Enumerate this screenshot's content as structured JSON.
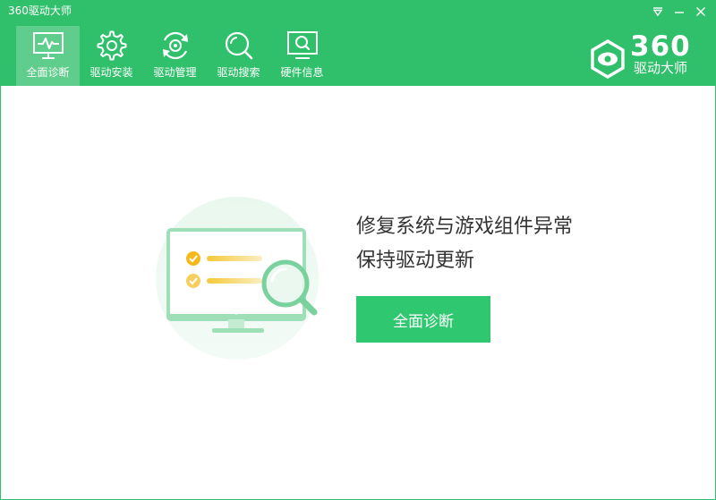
{
  "app": {
    "title": "360驱动大师"
  },
  "window_controls": [
    {
      "name": "menu",
      "icon": "dropdown-triangle-icon"
    },
    {
      "name": "minimize",
      "icon": "minimize-icon"
    },
    {
      "name": "close",
      "icon": "close-icon"
    }
  ],
  "toolbar": {
    "items": [
      {
        "label": "全面诊断",
        "icon": "monitor-pulse-icon",
        "active": true
      },
      {
        "label": "驱动安装",
        "icon": "gear-icon",
        "active": false
      },
      {
        "label": "驱动管理",
        "icon": "refresh-gear-icon",
        "active": false
      },
      {
        "label": "驱动搜索",
        "icon": "search-icon",
        "active": false
      },
      {
        "label": "硬件信息",
        "icon": "monitor-search-icon",
        "active": false
      }
    ]
  },
  "logo": {
    "number": "360",
    "name": "驱动大师"
  },
  "main": {
    "headline_line1": "修复系统与游戏组件异常",
    "headline_line2": "保持驱动更新",
    "scan_button": "全面诊断"
  },
  "colors": {
    "brand_green": "#30bf6b",
    "active_tab": "#5fcd8b",
    "button_green": "#2fc76f",
    "check_yellow": "#f5b91e"
  }
}
